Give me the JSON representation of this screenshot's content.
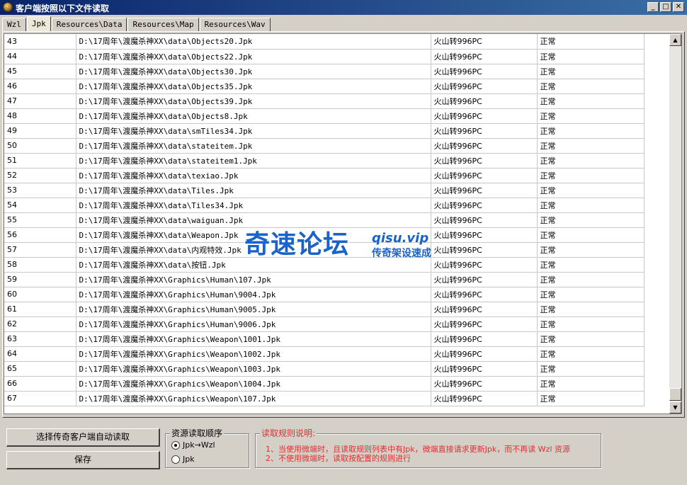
{
  "window": {
    "title": "客户端按照以下文件读取",
    "buttons": {
      "minimize": "_",
      "maximize": "□",
      "close": "✕"
    }
  },
  "tabs": [
    {
      "label": "Wzl",
      "active": false
    },
    {
      "label": "Jpk",
      "active": true
    },
    {
      "label": "Resources\\Data",
      "active": false
    },
    {
      "label": "Resources\\Map",
      "active": false
    },
    {
      "label": "Resources\\Wav",
      "active": false
    }
  ],
  "rows": [
    {
      "num": "43",
      "path": "D:\\17周年\\渡魔杀神XX\\data\\Objects20.Jpk",
      "version": "火山转996PC",
      "status": "正常"
    },
    {
      "num": "44",
      "path": "D:\\17周年\\渡魔杀神XX\\data\\Objects22.Jpk",
      "version": "火山转996PC",
      "status": "正常"
    },
    {
      "num": "45",
      "path": "D:\\17周年\\渡魔杀神XX\\data\\Objects30.Jpk",
      "version": "火山转996PC",
      "status": "正常"
    },
    {
      "num": "46",
      "path": "D:\\17周年\\渡魔杀神XX\\data\\Objects35.Jpk",
      "version": "火山转996PC",
      "status": "正常"
    },
    {
      "num": "47",
      "path": "D:\\17周年\\渡魔杀神XX\\data\\Objects39.Jpk",
      "version": "火山转996PC",
      "status": "正常"
    },
    {
      "num": "48",
      "path": "D:\\17周年\\渡魔杀神XX\\data\\Objects8.Jpk",
      "version": "火山转996PC",
      "status": "正常"
    },
    {
      "num": "49",
      "path": "D:\\17周年\\渡魔杀神XX\\data\\smTiles34.Jpk",
      "version": "火山转996PC",
      "status": "正常"
    },
    {
      "num": "50",
      "path": "D:\\17周年\\渡魔杀神XX\\data\\stateitem.Jpk",
      "version": "火山转996PC",
      "status": "正常"
    },
    {
      "num": "51",
      "path": "D:\\17周年\\渡魔杀神XX\\data\\stateitem1.Jpk",
      "version": "火山转996PC",
      "status": "正常"
    },
    {
      "num": "52",
      "path": "D:\\17周年\\渡魔杀神XX\\data\\texiao.Jpk",
      "version": "火山转996PC",
      "status": "正常"
    },
    {
      "num": "53",
      "path": "D:\\17周年\\渡魔杀神XX\\data\\Tiles.Jpk",
      "version": "火山转996PC",
      "status": "正常"
    },
    {
      "num": "54",
      "path": "D:\\17周年\\渡魔杀神XX\\data\\Tiles34.Jpk",
      "version": "火山转996PC",
      "status": "正常"
    },
    {
      "num": "55",
      "path": "D:\\17周年\\渡魔杀神XX\\data\\waiguan.Jpk",
      "version": "火山转996PC",
      "status": "正常"
    },
    {
      "num": "56",
      "path": "D:\\17周年\\渡魔杀神XX\\data\\Weapon.Jpk",
      "version": "火山转996PC",
      "status": "正常"
    },
    {
      "num": "57",
      "path": "D:\\17周年\\渡魔杀神XX\\data\\内观特效.Jpk",
      "version": "火山转996PC",
      "status": "正常"
    },
    {
      "num": "58",
      "path": "D:\\17周年\\渡魔杀神XX\\data\\按钮.Jpk",
      "version": "火山转996PC",
      "status": "正常"
    },
    {
      "num": "59",
      "path": "D:\\17周年\\渡魔杀神XX\\Graphics\\Human\\107.Jpk",
      "version": "火山转996PC",
      "status": "正常"
    },
    {
      "num": "60",
      "path": "D:\\17周年\\渡魔杀神XX\\Graphics\\Human\\9004.Jpk",
      "version": "火山转996PC",
      "status": "正常"
    },
    {
      "num": "61",
      "path": "D:\\17周年\\渡魔杀神XX\\Graphics\\Human\\9005.Jpk",
      "version": "火山转996PC",
      "status": "正常"
    },
    {
      "num": "62",
      "path": "D:\\17周年\\渡魔杀神XX\\Graphics\\Human\\9006.Jpk",
      "version": "火山转996PC",
      "status": "正常"
    },
    {
      "num": "63",
      "path": "D:\\17周年\\渡魔杀神XX\\Graphics\\Weapon\\1001.Jpk",
      "version": "火山转996PC",
      "status": "正常"
    },
    {
      "num": "64",
      "path": "D:\\17周年\\渡魔杀神XX\\Graphics\\Weapon\\1002.Jpk",
      "version": "火山转996PC",
      "status": "正常"
    },
    {
      "num": "65",
      "path": "D:\\17周年\\渡魔杀神XX\\Graphics\\Weapon\\1003.Jpk",
      "version": "火山转996PC",
      "status": "正常"
    },
    {
      "num": "66",
      "path": "D:\\17周年\\渡魔杀神XX\\Graphics\\Weapon\\1004.Jpk",
      "version": "火山转996PC",
      "status": "正常"
    },
    {
      "num": "67",
      "path": "D:\\17周年\\渡魔杀神XX\\Graphics\\Weapon\\107.Jpk",
      "version": "火山转996PC",
      "status": "正常"
    }
  ],
  "scrollbar": {
    "up": "▲",
    "down": "▼"
  },
  "actions": {
    "auto_read": "选择传奇客户端自动读取",
    "save": "保存"
  },
  "read_order": {
    "title": "资源读取顺序",
    "options": [
      {
        "label": "Jpk→Wzl",
        "selected": true
      },
      {
        "label": "Jpk",
        "selected": false
      }
    ]
  },
  "rules": {
    "title": "读取规则说明:",
    "lines": [
      "1、当使用微端时，且读取规则列表中有Jpk，微端直接请求更新Jpk，而不再读 Wzl 资源",
      "2、不使用微端时，读取按配置的规则进行"
    ],
    "color": "#e03030"
  },
  "watermark": {
    "main": "奇速论坛",
    "site": "qisu.vip",
    "sub": "传奇架设速成",
    "color": "#1a63c8"
  }
}
